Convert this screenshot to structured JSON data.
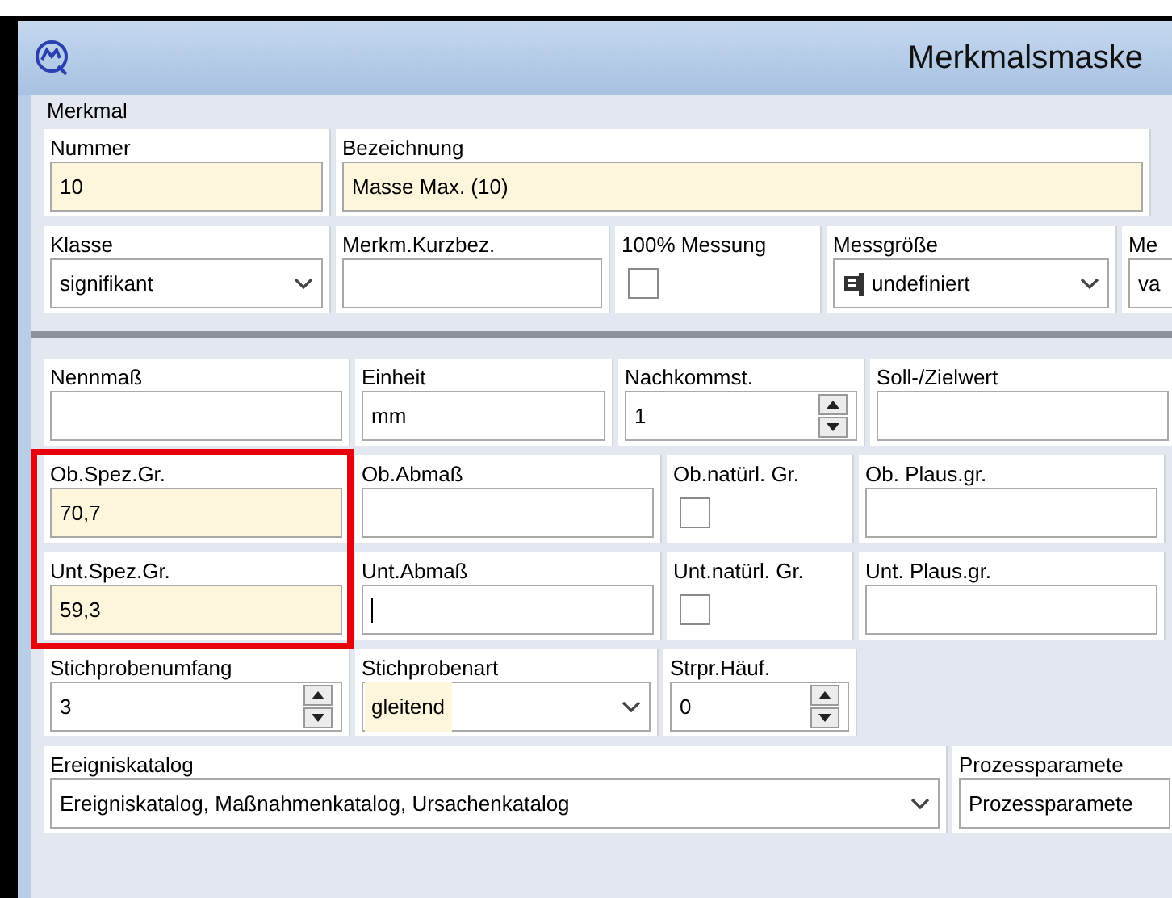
{
  "window": {
    "title": "Merkmalsmaske"
  },
  "group": {
    "label": "Merkmal"
  },
  "sections": [
    {
      "rows": [
        {
          "cells": [
            {
              "label": "Nummer",
              "kind": "text",
              "value": "10",
              "highlighted": true
            },
            {
              "label": "Bezeichnung",
              "kind": "text",
              "value": "Masse Max. (10)",
              "highlighted": true
            }
          ]
        },
        {
          "cells": [
            {
              "label": "Klasse",
              "kind": "combo",
              "value": "signifikant"
            },
            {
              "label": "Merkm.Kurzbez.",
              "kind": "text"
            },
            {
              "label": "100% Messung",
              "kind": "check",
              "checked": false
            },
            {
              "label": "Messgröße",
              "kind": "combo-icon",
              "value": "undefiniert"
            },
            {
              "label": "Me",
              "kind": "text",
              "value": "va"
            }
          ]
        }
      ]
    },
    {
      "rows": [
        {
          "cells": [
            {
              "label": "Nennmaß",
              "kind": "text"
            },
            {
              "label": "Einheit",
              "kind": "text",
              "value": "mm"
            },
            {
              "label": "Nachkommst.",
              "kind": "spin",
              "value": "1"
            },
            {
              "label": "Soll-/Zielwert",
              "kind": "text"
            }
          ]
        },
        {
          "cells": [
            {
              "label": "Ob.Spez.Gr.",
              "kind": "text",
              "value": "70,7",
              "highlighted": true,
              "outlined": true
            },
            {
              "label": "Ob.Abmaß",
              "kind": "text"
            },
            {
              "label": "Ob.natürl. Gr.",
              "kind": "check",
              "checked": false
            },
            {
              "label": "Ob. Plaus.gr.",
              "kind": "text"
            }
          ]
        },
        {
          "cells": [
            {
              "label": "Unt.Spez.Gr.",
              "kind": "text",
              "value": "59,3",
              "highlighted": true,
              "outlined": true
            },
            {
              "label": "Unt.Abmaß",
              "kind": "text",
              "focused": true
            },
            {
              "label": "Unt.natürl. Gr.",
              "kind": "check",
              "checked": false
            },
            {
              "label": "Unt. Plaus.gr.",
              "kind": "text"
            }
          ]
        },
        {
          "cells": [
            {
              "label": "Stichprobenumfang",
              "kind": "spin",
              "value": "3"
            },
            {
              "label": "Stichprobenart",
              "kind": "combo",
              "value": "gleitend",
              "highlighted": true
            },
            {
              "label": "Strpr.Häuf.",
              "kind": "spin",
              "value": "0"
            }
          ]
        },
        {
          "cells": [
            {
              "label": "Ereigniskatalog",
              "kind": "combo",
              "value": "Ereigniskatalog, Maßnahmenkatalog, Ursachenkatalog"
            },
            {
              "label": "Prozessparamete",
              "kind": "text",
              "value": "Prozessparamete"
            }
          ]
        }
      ]
    }
  ]
}
